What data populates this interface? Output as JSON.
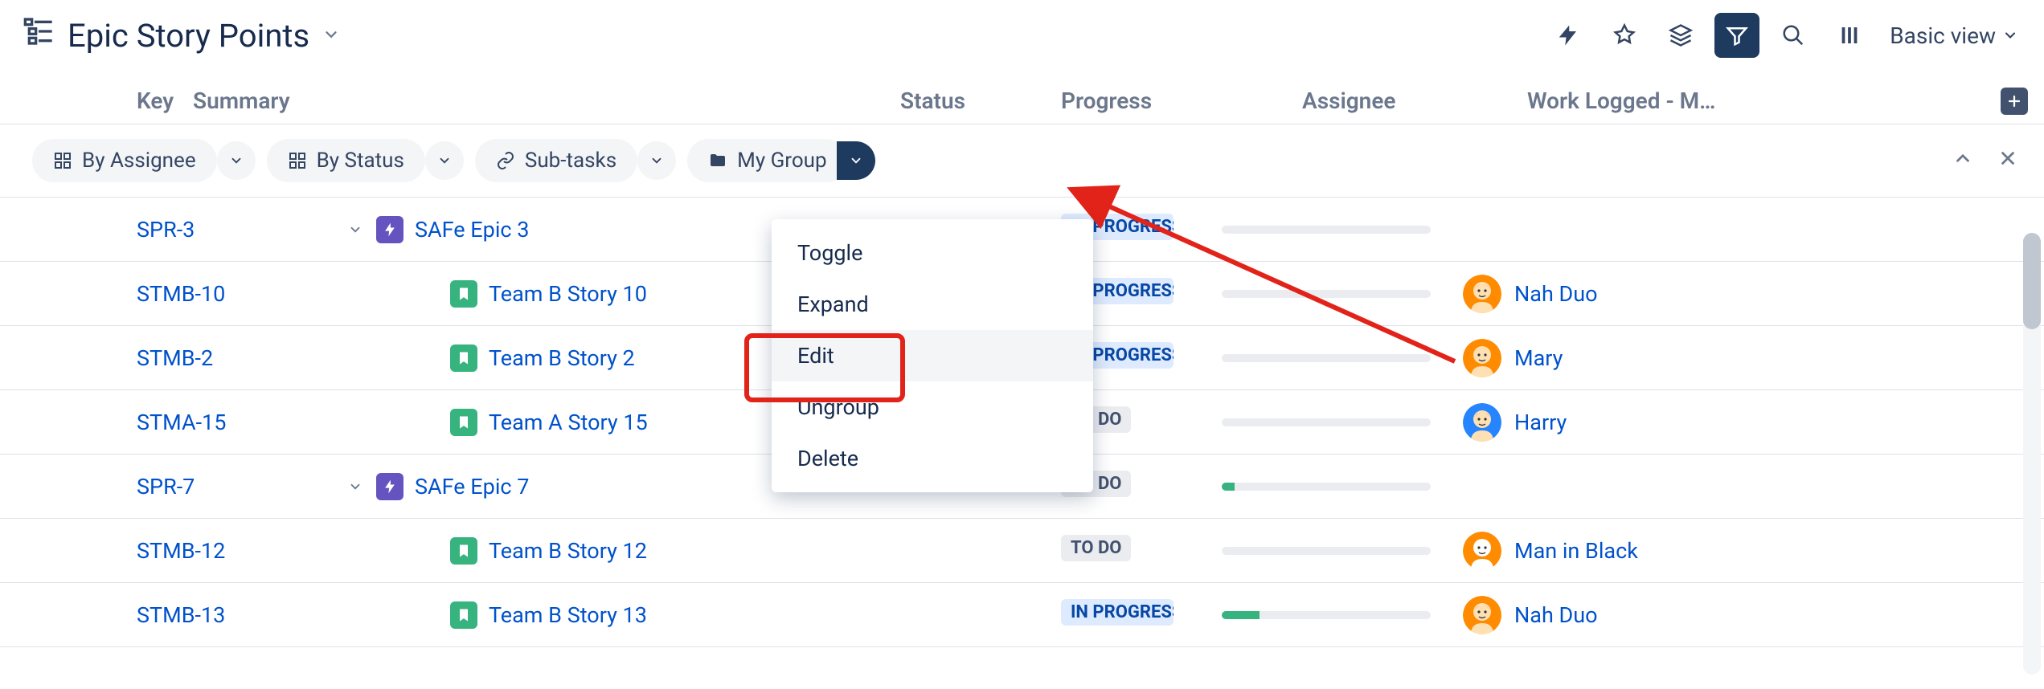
{
  "header": {
    "title": "Epic Story Points",
    "view_label": "Basic view"
  },
  "columns": {
    "key": "Key",
    "summary": "Summary",
    "status": "Status",
    "progress": "Progress",
    "assignee": "Assignee",
    "work_logged": "Work Logged - M…"
  },
  "chips": {
    "by_assignee": "By Assignee",
    "by_status": "By Status",
    "sub_tasks": "Sub-tasks",
    "my_group": "My Group"
  },
  "menu": {
    "toggle": "Toggle",
    "expand": "Expand",
    "edit": "Edit",
    "ungroup": "Ungroup",
    "delete": "Delete"
  },
  "rows": [
    {
      "key": "SPR-3",
      "summary": "SAFe Epic 3",
      "type": "epic",
      "level": 0,
      "status": "IN PROGRESS",
      "status_kind": "inprogress",
      "progress": 0,
      "assignee": null,
      "avatar": null
    },
    {
      "key": "STMB-10",
      "summary": "Team B Story 10",
      "type": "story",
      "level": 1,
      "status": "IN PROGRESS",
      "status_kind": "inprogress",
      "progress": 0,
      "assignee": "Nah Duo",
      "avatar": "orange"
    },
    {
      "key": "STMB-2",
      "summary": "Team B Story 2",
      "type": "story",
      "level": 1,
      "status": "IN PROGRESS",
      "status_kind": "inprogress",
      "progress": 0,
      "assignee": "Mary",
      "avatar": "orange2"
    },
    {
      "key": "STMA-15",
      "summary": "Team A Story 15",
      "type": "story",
      "level": 1,
      "status": "TO DO",
      "status_kind": "todo",
      "progress": 0,
      "assignee": "Harry",
      "avatar": "blue"
    },
    {
      "key": "SPR-7",
      "summary": "SAFe Epic 7",
      "type": "epic",
      "level": 0,
      "status": "TO DO",
      "status_kind": "todo",
      "progress": 6,
      "assignee": null,
      "avatar": null
    },
    {
      "key": "STMB-12",
      "summary": "Team B Story 12",
      "type": "story",
      "level": 1,
      "status": "TO DO",
      "status_kind": "todo",
      "progress": 0,
      "assignee": "Man in Black",
      "avatar": "orange3"
    },
    {
      "key": "STMB-13",
      "summary": "Team B Story 13",
      "type": "story",
      "level": 1,
      "status": "IN PROGRESS",
      "status_kind": "inprogress",
      "progress": 18,
      "assignee": "Nah Duo",
      "avatar": "orange"
    }
  ],
  "avatars": {
    "orange": {
      "bg": "#ff8b00",
      "face": "#ffe0b2",
      "hair": "#d84315"
    },
    "orange2": {
      "bg": "#ff8b00",
      "face": "#ffe0b2",
      "hair": "#ffb300"
    },
    "blue": {
      "bg": "#2684ff",
      "face": "#ffe0b2",
      "hair": "#5e4331"
    },
    "orange3": {
      "bg": "#ff8b00",
      "face": "#fff",
      "hair": "#fff"
    }
  }
}
